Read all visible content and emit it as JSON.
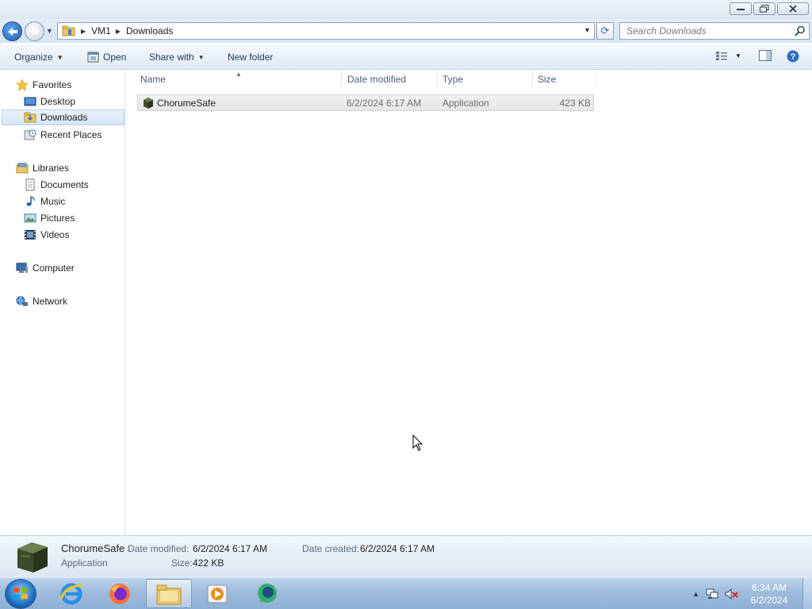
{
  "window": {
    "title": "",
    "controls": [
      "minimize",
      "maximize",
      "close"
    ]
  },
  "address_bar": {
    "crumbs": [
      "VM1",
      "Downloads"
    ]
  },
  "search": {
    "placeholder": "Search Downloads"
  },
  "toolbar": {
    "organize_label": "Organize",
    "open_label": "Open",
    "share_label": "Share with",
    "new_folder_label": "New folder"
  },
  "nav": {
    "favorites": {
      "label": "Favorites",
      "items": [
        {
          "label": "Desktop",
          "icon": "desktop-icon"
        },
        {
          "label": "Downloads",
          "icon": "downloads-folder-icon",
          "selected": true
        },
        {
          "label": "Recent Places",
          "icon": "recent-places-icon"
        }
      ]
    },
    "libraries": {
      "label": "Libraries",
      "items": [
        {
          "label": "Documents",
          "icon": "documents-icon"
        },
        {
          "label": "Music",
          "icon": "music-icon"
        },
        {
          "label": "Pictures",
          "icon": "pictures-icon"
        },
        {
          "label": "Videos",
          "icon": "videos-icon"
        }
      ]
    },
    "computer_label": "Computer",
    "network_label": "Network"
  },
  "columns": [
    "Name",
    "Date modified",
    "Type",
    "Size"
  ],
  "files": [
    {
      "name": "ChorumeSafe",
      "date_modified": "6/2/2024 6:17 AM",
      "type": "Application",
      "size": "423 KB",
      "icon": "application-icon"
    }
  ],
  "details": {
    "name": "ChorumeSafe",
    "type": "Application",
    "date_modified_label": "Date modified:",
    "date_modified": "6/2/2024 6:17 AM",
    "date_created_label": "Date created:",
    "date_created": "6/2/2024 6:17 AM",
    "size_label": "Size:",
    "size": "422 KB"
  },
  "taskbar": {
    "apps": [
      "internet-explorer-icon",
      "firefox-icon",
      "file-explorer-icon",
      "media-player-icon",
      "chat-app-icon"
    ],
    "clock_time": "6:34 AM",
    "clock_date": "6/2/2024"
  }
}
